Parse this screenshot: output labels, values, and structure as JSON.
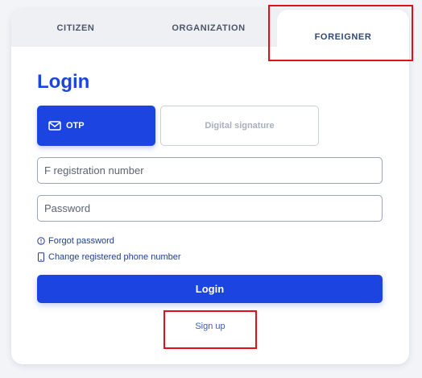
{
  "tabs": [
    {
      "label": "CITIZEN"
    },
    {
      "label": "ORGANIZATION"
    },
    {
      "label": "FOREIGNER",
      "active": true
    }
  ],
  "form": {
    "title": "Login",
    "methods": {
      "otp": {
        "label": "OTP",
        "icon": "mail-icon",
        "active": true
      },
      "signature": {
        "label": "Digital signature"
      }
    },
    "registration_number": {
      "placeholder": "F registration number",
      "value": ""
    },
    "password": {
      "placeholder": "Password",
      "value": ""
    },
    "links": {
      "forgot_password": {
        "label": "Forgot password",
        "icon": "info-icon"
      },
      "change_phone": {
        "label": "Change registered phone number",
        "icon": "phone-icon"
      }
    },
    "login_button": "Login",
    "signup_link": "Sign up"
  },
  "colors": {
    "primary": "#1c44e0",
    "highlight": "#e3101a"
  }
}
